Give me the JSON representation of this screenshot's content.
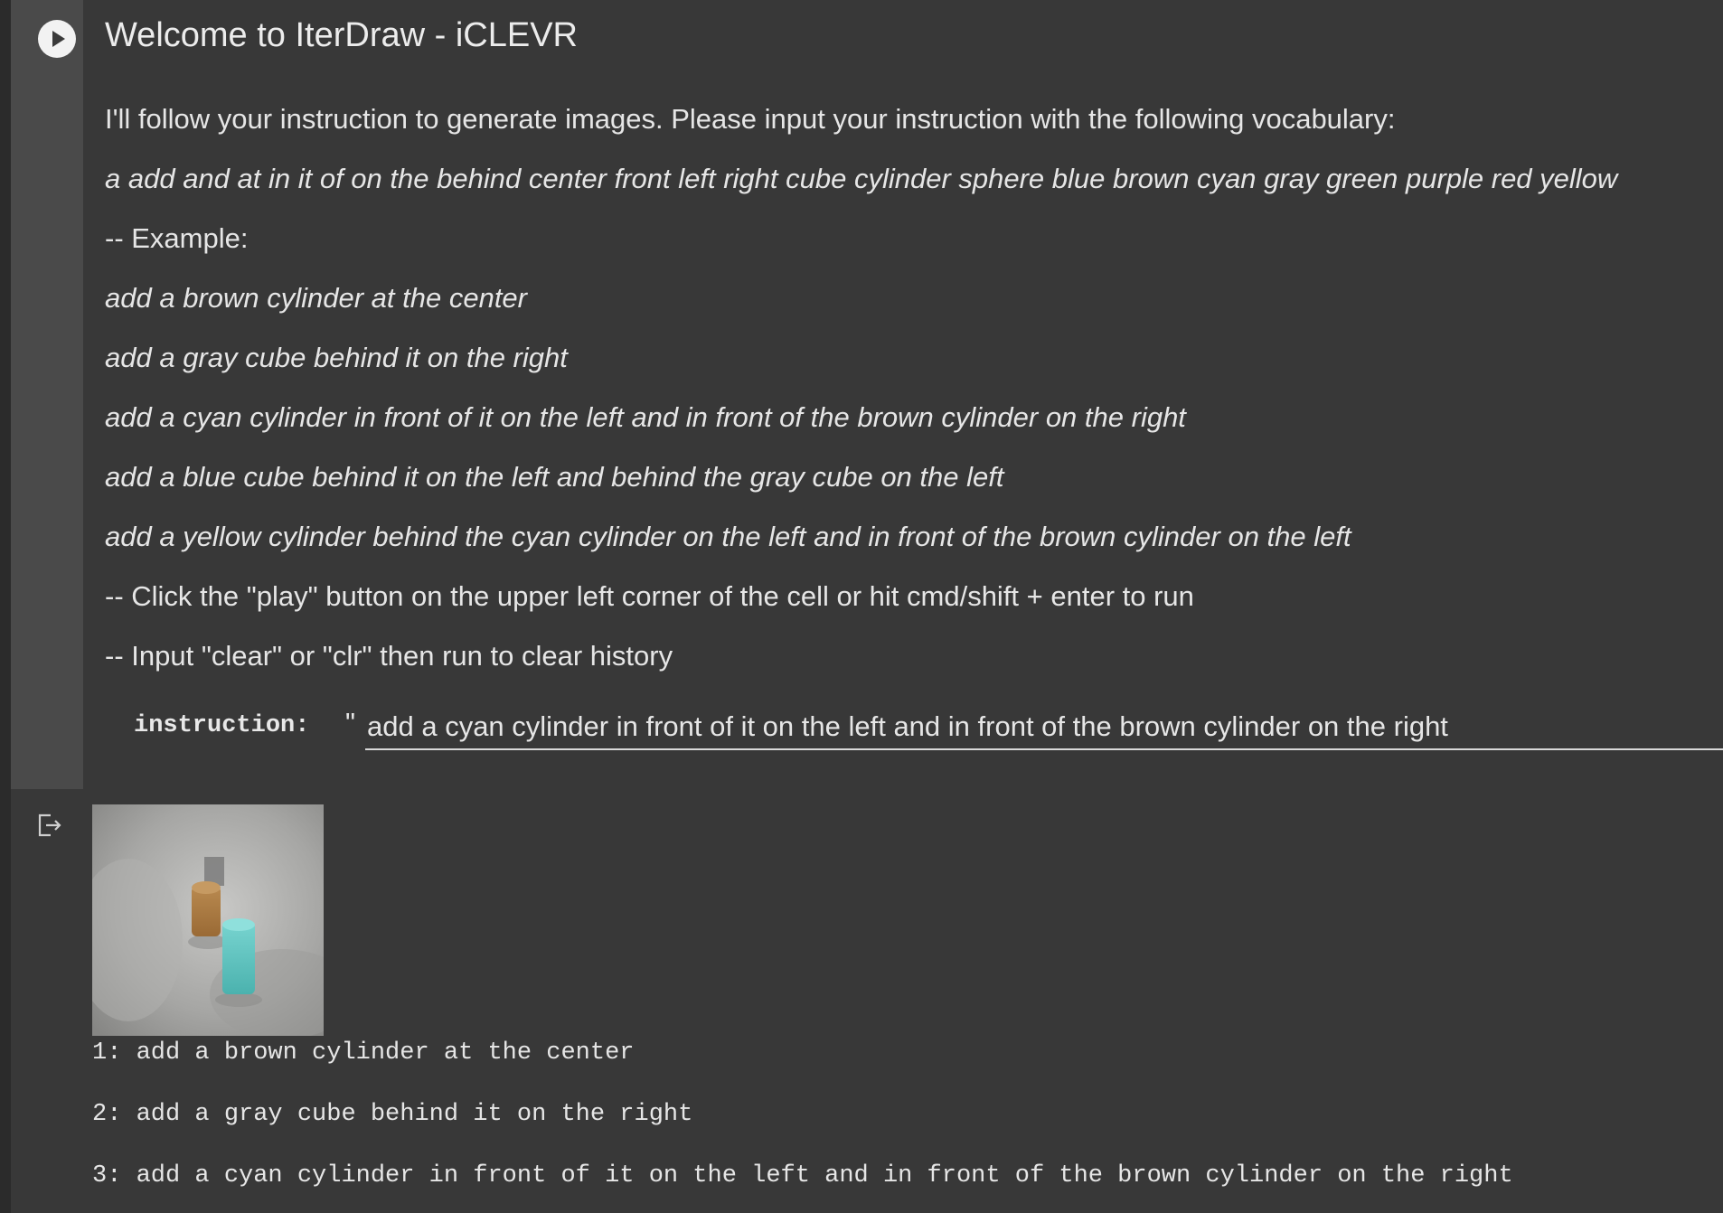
{
  "cell": {
    "title": "Welcome to IterDraw - iCLEVR",
    "intro": "I'll follow your instruction to generate images. Please input your instruction with the following vocabulary:",
    "vocabulary": "a add and at in it of on the behind center front left right cube cylinder sphere blue brown cyan gray green purple red yellow",
    "example_header": "-- Example:",
    "examples": [
      "add a brown cylinder at the center",
      "add a gray cube behind it on the right",
      "add a cyan cylinder in front of it on the left and in front of the brown cylinder on the right",
      "add a blue cube behind it on the left and behind the gray cube on the left",
      "add a yellow cylinder behind the cyan cylinder on the left and in front of the brown cylinder on the left"
    ],
    "tips": [
      "-- Click the \"play\" button on the upper left corner of the cell or hit cmd/shift + enter to run",
      "-- Input \"clear\" or \"clr\" then run to clear history"
    ],
    "param": {
      "label": "instruction:",
      "quote": "\"",
      "value": "add a cyan cylinder in front of it on the left and in front of the brown cylinder on the right"
    },
    "run_icon": "play-icon"
  },
  "output": {
    "icon": "output-redirect-icon",
    "image_description_icon": "rendered-scene-image",
    "history": [
      "1: add a brown cylinder at the center",
      "2: add a gray cube behind it on the right",
      "3: add a cyan cylinder in front of it on the left and in front of the brown cylinder on the right"
    ]
  }
}
